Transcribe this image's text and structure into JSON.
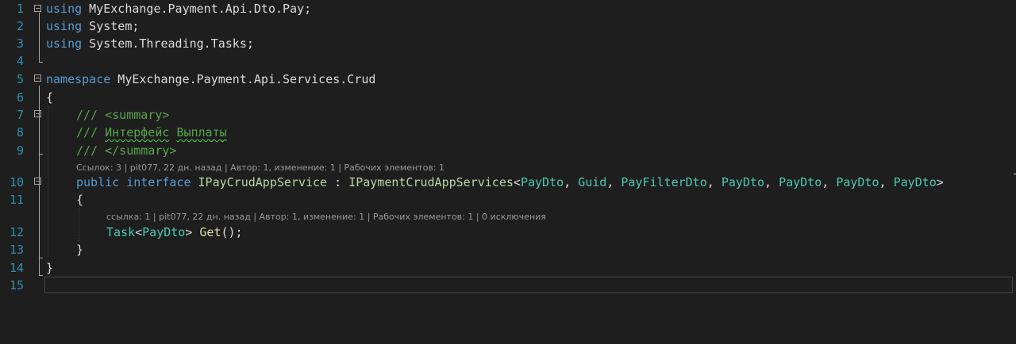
{
  "line_numbers": [
    "1",
    "2",
    "3",
    "4",
    "5",
    "6",
    "7",
    "8",
    "9",
    "10",
    "11",
    "12",
    "13",
    "14",
    "15"
  ],
  "code": {
    "l1": {
      "kw": "using",
      "rest": " MyExchange.Payment.Api.Dto.Pay;"
    },
    "l2": {
      "kw": "using",
      "rest": " System;"
    },
    "l3": {
      "kw": "using",
      "rest": " System.Threading.Tasks;"
    },
    "l5": {
      "kw": "namespace",
      "rest": " MyExchange.Payment.Api.Services.Crud"
    },
    "l6": "{",
    "l7": "/// <summary>",
    "l8a": "/// ",
    "l8b": "Интерфейс",
    "l8c": " ",
    "l8d": "Выплаты",
    "l9": "/// </summary>",
    "l10": {
      "kw1": "public",
      "kw2": "interface",
      "name": "IPayCrudAppService",
      "colon": " : ",
      "base": "IPaymentCrudAppServices",
      "lt": "<",
      "args": [
        "PayDto",
        "Guid",
        "PayFilterDto",
        "PayDto",
        "PayDto",
        "PayDto",
        "PayDto"
      ],
      "sep": ", ",
      "gt": ">"
    },
    "l11": "{",
    "l12": {
      "type": "Task",
      "lt": "<",
      "arg": "PayDto",
      "gt": ">",
      "space": " ",
      "method": "Get",
      "tail": "();"
    },
    "l13": "}",
    "l14": "}"
  },
  "codelens": {
    "interface": "Ссылок: 3 | pit077, 22 дн. назад | Автор: 1, изменение: 1 | Рабочих элементов: 1",
    "method": "ссылка: 1 | pit077, 22 дн. назад | Автор: 1, изменение: 1 | Рабочих элементов: 1 | 0 исключения"
  },
  "colors": {
    "background": "#1e1e1e",
    "keyword": "#569cd6",
    "type": "#4ec9b0",
    "interface": "#b8d7a3",
    "comment": "#57a64a",
    "method": "#dcdcaa",
    "line_number": "#2b91af",
    "codelens": "#999999"
  }
}
